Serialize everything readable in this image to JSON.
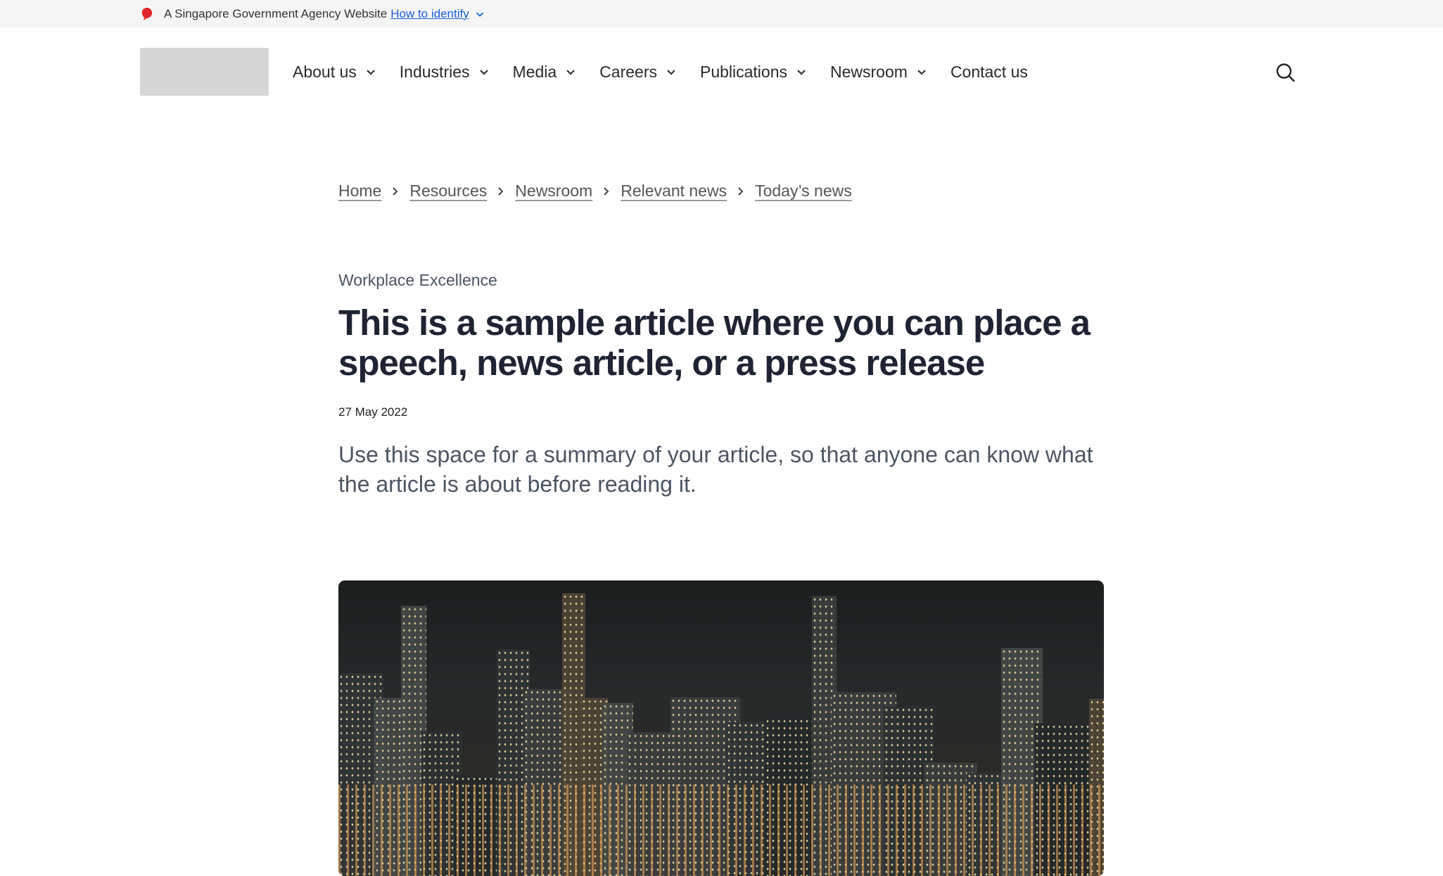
{
  "masthead": {
    "text": "A Singapore Government Agency Website",
    "link": "How to identify"
  },
  "nav": {
    "items": [
      {
        "label": "About us",
        "dropdown": true
      },
      {
        "label": "Industries",
        "dropdown": true
      },
      {
        "label": "Media",
        "dropdown": true
      },
      {
        "label": "Careers",
        "dropdown": true
      },
      {
        "label": "Publications",
        "dropdown": true
      },
      {
        "label": "Newsroom",
        "dropdown": true
      },
      {
        "label": "Contact us",
        "dropdown": false
      }
    ]
  },
  "breadcrumb": [
    "Home",
    "Resources",
    "Newsroom",
    "Relevant news",
    "Today’s news"
  ],
  "article": {
    "category": "Workplace Excellence",
    "title": "This is a sample article where you can place a speech, news article, or a press release",
    "date": "27 May 2022",
    "summary": "Use this space for a summary of your article, so that anyone can know what the article is about before reading it."
  },
  "colors": {
    "link": "#1a5fd6",
    "lion": "#e0262a",
    "title": "#1e2433"
  }
}
